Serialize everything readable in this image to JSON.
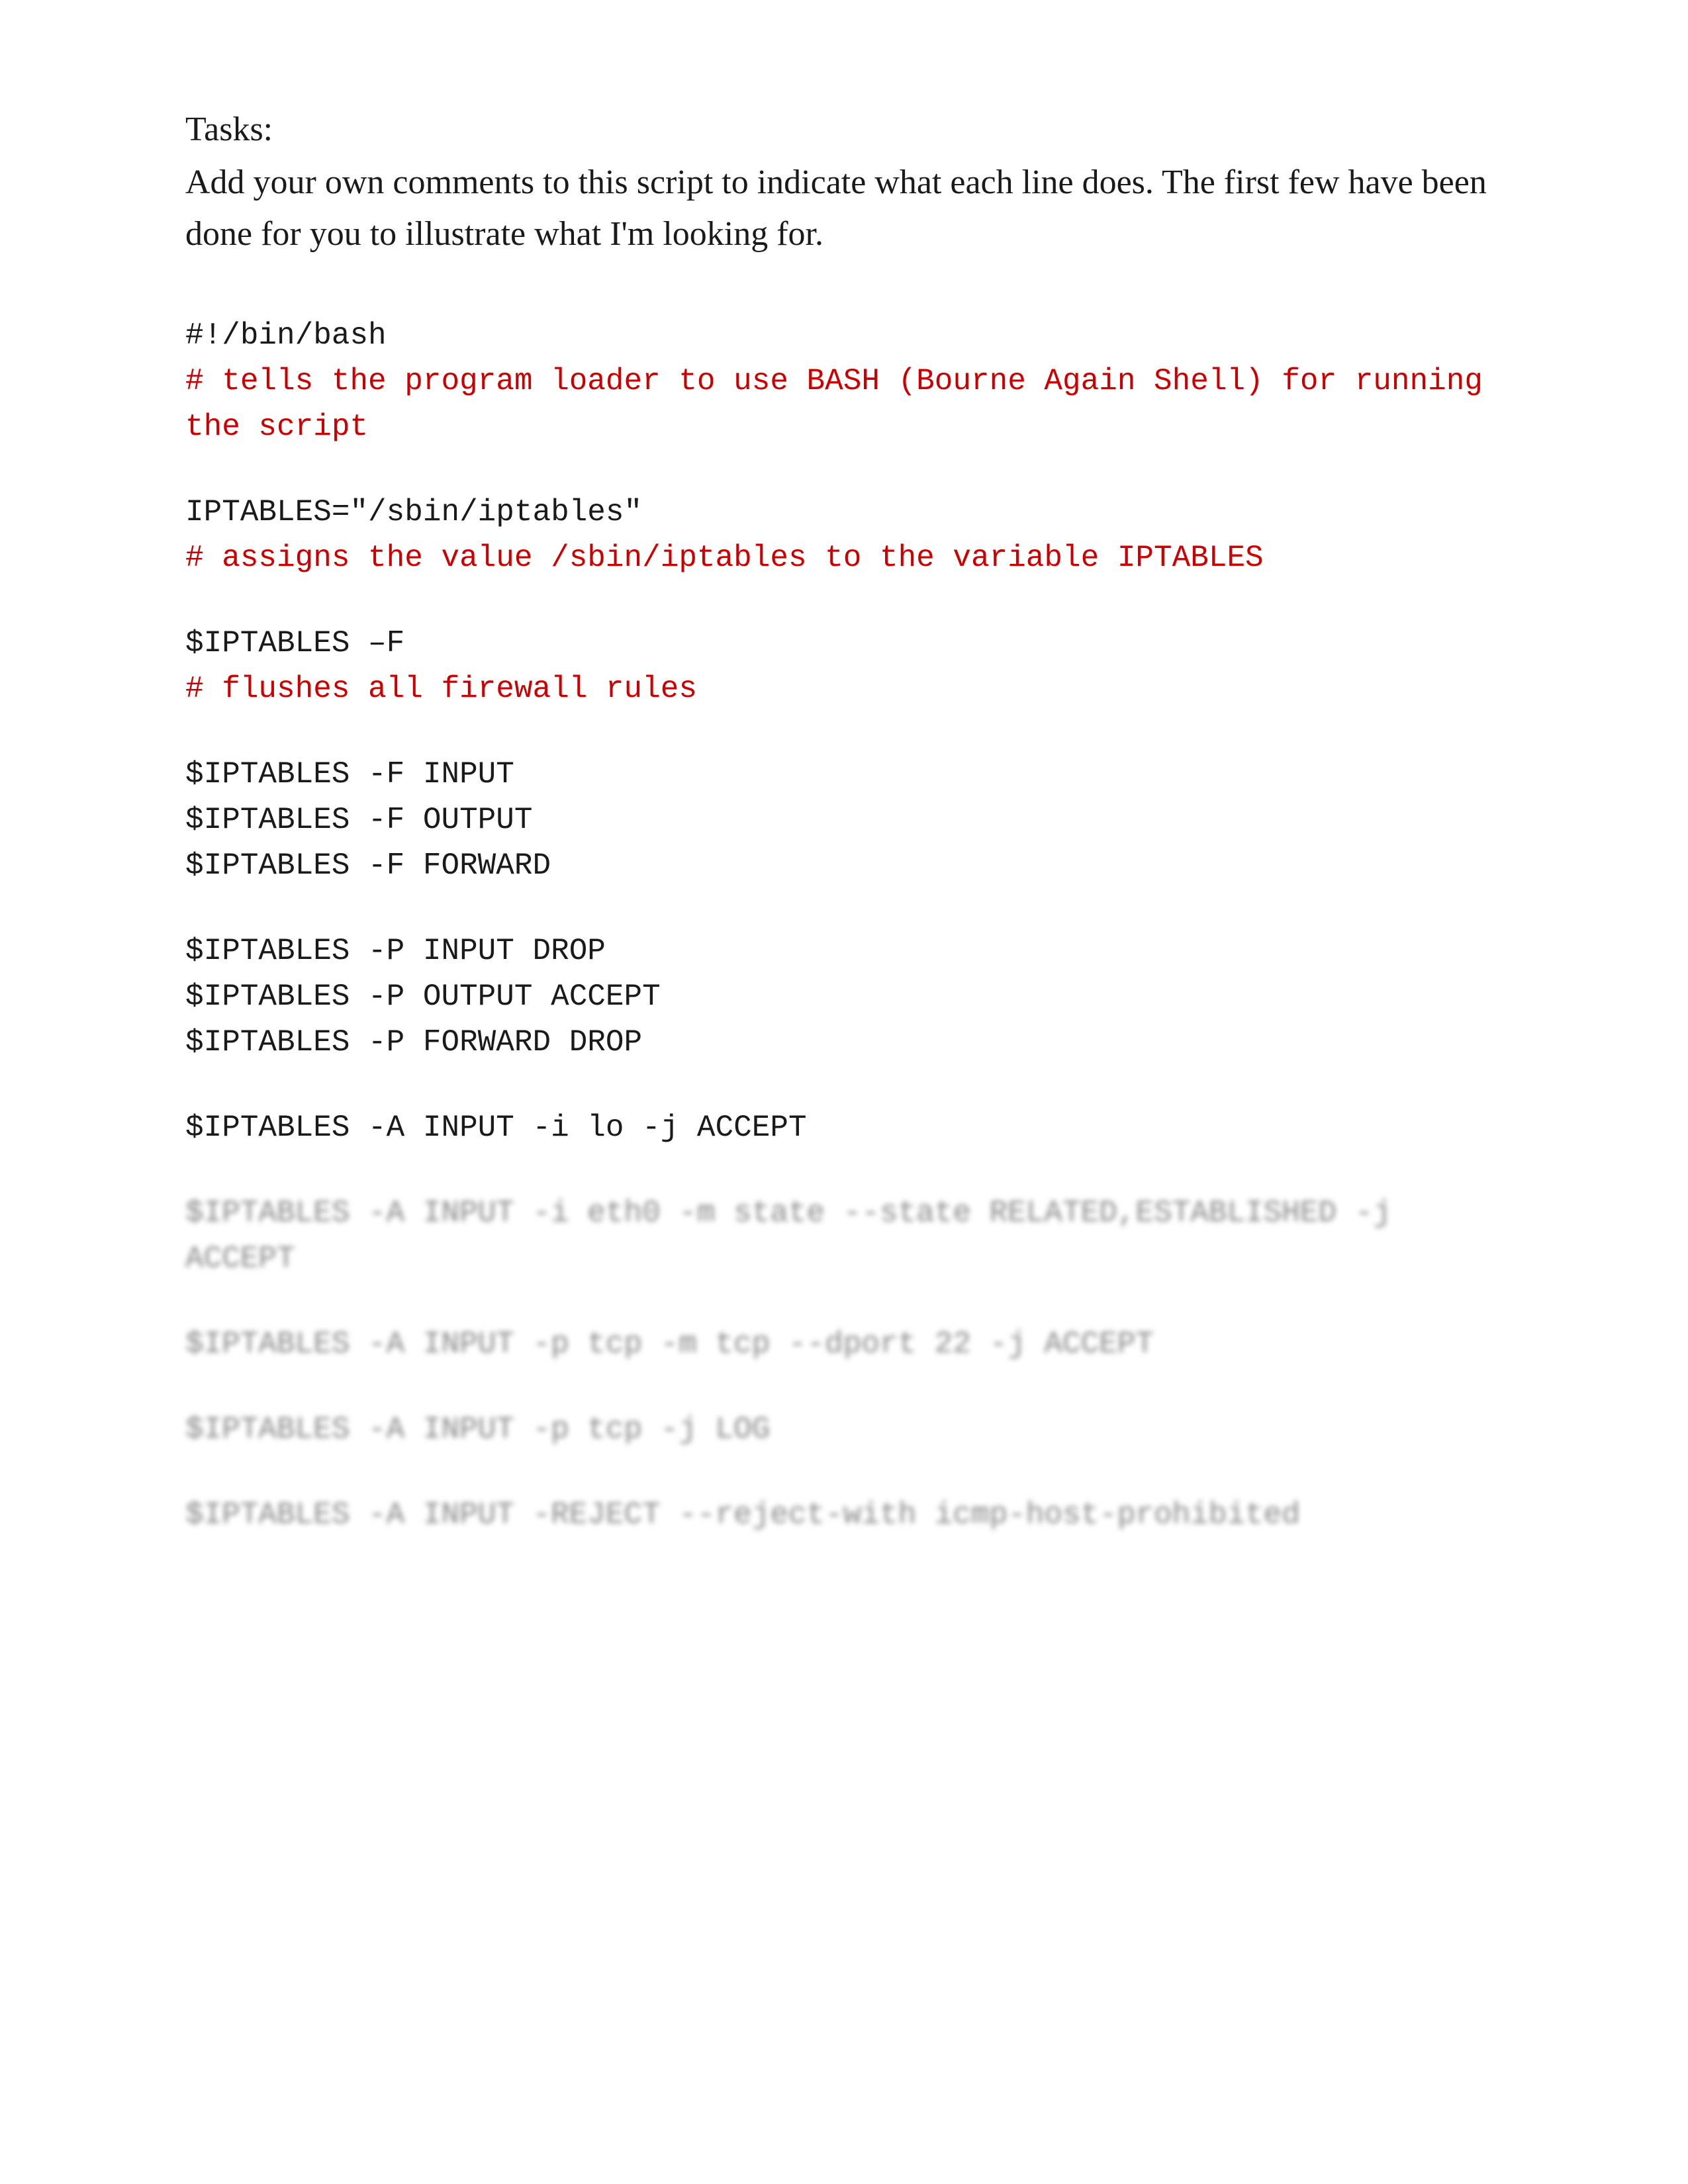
{
  "page": {
    "tasks_label": "Tasks:",
    "tasks_description": "Add your own comments to this script to indicate what each line does.  The first few have been done for you to illustrate what I'm looking for.",
    "code_blocks": [
      {
        "id": "shebang",
        "lines": [
          {
            "text": "#!/bin/bash",
            "type": "code"
          },
          {
            "text": "# tells the program loader to use BASH (Bourne Again Shell) for running the script",
            "type": "comment"
          }
        ]
      },
      {
        "id": "iptables-var",
        "lines": [
          {
            "text": "IPTABLES=\"/sbin/iptables\"",
            "type": "code"
          },
          {
            "text": "# assigns the value /sbin/iptables to the variable IPTABLES",
            "type": "comment"
          }
        ]
      },
      {
        "id": "flush-all",
        "lines": [
          {
            "text": "$IPTABLES –F",
            "type": "code"
          },
          {
            "text": "# flushes all firewall rules",
            "type": "comment"
          }
        ]
      },
      {
        "id": "flush-chains",
        "lines": [
          {
            "text": "$IPTABLES -F INPUT",
            "type": "code"
          },
          {
            "text": "$IPTABLES -F OUTPUT",
            "type": "code"
          },
          {
            "text": "$IPTABLES -F FORWARD",
            "type": "code"
          }
        ]
      },
      {
        "id": "policy-drop",
        "lines": [
          {
            "text": "$IPTABLES -P INPUT DROP",
            "type": "code"
          },
          {
            "text": "$IPTABLES -P OUTPUT ACCEPT",
            "type": "code"
          },
          {
            "text": "$IPTABLES -P FORWARD DROP",
            "type": "code"
          }
        ]
      },
      {
        "id": "loopback",
        "lines": [
          {
            "text": "$IPTABLES -A INPUT -i lo -j ACCEPT",
            "type": "code"
          }
        ]
      },
      {
        "id": "blurred-1",
        "lines": [
          {
            "text": "$IPTABLES -A INPUT -i eth0 -m state --state RELATED,ESTABLISHED -j ACCEPT",
            "type": "blurred"
          }
        ]
      },
      {
        "id": "blurred-2",
        "lines": [
          {
            "text": "$IPTABLES -A INPUT -p tcp -m tcp --dport 22 -j ACCEPT",
            "type": "blurred"
          }
        ]
      },
      {
        "id": "blurred-3",
        "lines": [
          {
            "text": "$IPTABLES -A INPUT -p tcp -j LOG",
            "type": "blurred"
          }
        ]
      },
      {
        "id": "blurred-4",
        "lines": [
          {
            "text": "$IPTABLES -A INPUT -REJECT --reject-with icmp-host-prohibited",
            "type": "blurred"
          }
        ]
      }
    ]
  }
}
